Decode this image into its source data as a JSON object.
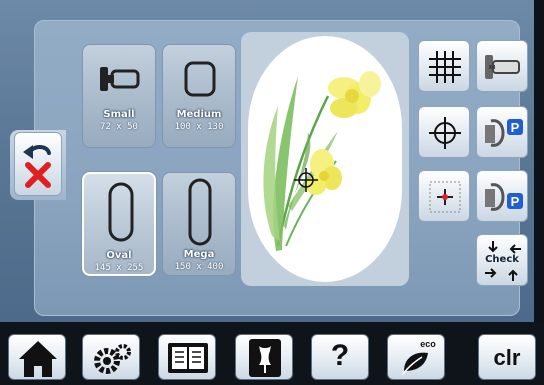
{
  "hoop_sizes": [
    {
      "name": "Small",
      "dimensions": "72 x 50",
      "icon": "free-arm-hoop-icon"
    },
    {
      "name": "Medium",
      "dimensions": "100 x 130",
      "icon": "medium-hoop-icon"
    },
    {
      "name": "Oval",
      "dimensions": "145 x 255",
      "icon": "oval-hoop-icon"
    },
    {
      "name": "Mega",
      "dimensions": "150 x 400",
      "icon": "mega-hoop-icon"
    }
  ],
  "selected_hoop": "Oval",
  "tools": {
    "grid": "grid-icon",
    "center": "crosshair-icon",
    "move_to_center": "center-move-icon",
    "hoop_side": "hoop-side-icon",
    "park_left": "park-position-icon",
    "park_right": "park-position-icon",
    "park_badge": "P",
    "check_label": "Check"
  },
  "back": {
    "undo": "undo-arrow-icon",
    "cancel": "cancel-x-icon"
  },
  "bottom_bar": {
    "home": "home-icon",
    "settings": "settings-gears-icon",
    "tutorial": "tutorial-book-icon",
    "creative_consultant": "dress-form-icon",
    "help_label": "?",
    "eco": "eco-leaf-icon",
    "eco_label": "eco",
    "clear_label": "clr"
  },
  "colors": {
    "accent_blue": "#1f5fd0",
    "cancel_red": "#e02020",
    "flower_yellow": "#f2ee6a",
    "stem_green": "#5ca64a"
  }
}
